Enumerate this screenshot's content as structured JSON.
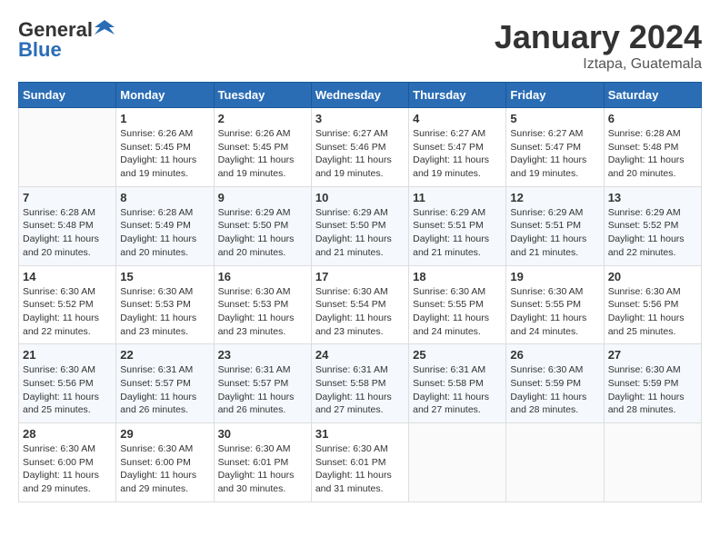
{
  "header": {
    "logo_general": "General",
    "logo_blue": "Blue",
    "month_title": "January 2024",
    "location": "Iztapa, Guatemala"
  },
  "weekdays": [
    "Sunday",
    "Monday",
    "Tuesday",
    "Wednesday",
    "Thursday",
    "Friday",
    "Saturday"
  ],
  "weeks": [
    [
      {
        "day": "",
        "info": ""
      },
      {
        "day": "1",
        "info": "Sunrise: 6:26 AM\nSunset: 5:45 PM\nDaylight: 11 hours and 19 minutes."
      },
      {
        "day": "2",
        "info": "Sunrise: 6:26 AM\nSunset: 5:45 PM\nDaylight: 11 hours and 19 minutes."
      },
      {
        "day": "3",
        "info": "Sunrise: 6:27 AM\nSunset: 5:46 PM\nDaylight: 11 hours and 19 minutes."
      },
      {
        "day": "4",
        "info": "Sunrise: 6:27 AM\nSunset: 5:47 PM\nDaylight: 11 hours and 19 minutes."
      },
      {
        "day": "5",
        "info": "Sunrise: 6:27 AM\nSunset: 5:47 PM\nDaylight: 11 hours and 19 minutes."
      },
      {
        "day": "6",
        "info": "Sunrise: 6:28 AM\nSunset: 5:48 PM\nDaylight: 11 hours and 20 minutes."
      }
    ],
    [
      {
        "day": "7",
        "info": "Sunrise: 6:28 AM\nSunset: 5:48 PM\nDaylight: 11 hours and 20 minutes."
      },
      {
        "day": "8",
        "info": "Sunrise: 6:28 AM\nSunset: 5:49 PM\nDaylight: 11 hours and 20 minutes."
      },
      {
        "day": "9",
        "info": "Sunrise: 6:29 AM\nSunset: 5:50 PM\nDaylight: 11 hours and 20 minutes."
      },
      {
        "day": "10",
        "info": "Sunrise: 6:29 AM\nSunset: 5:50 PM\nDaylight: 11 hours and 21 minutes."
      },
      {
        "day": "11",
        "info": "Sunrise: 6:29 AM\nSunset: 5:51 PM\nDaylight: 11 hours and 21 minutes."
      },
      {
        "day": "12",
        "info": "Sunrise: 6:29 AM\nSunset: 5:51 PM\nDaylight: 11 hours and 21 minutes."
      },
      {
        "day": "13",
        "info": "Sunrise: 6:29 AM\nSunset: 5:52 PM\nDaylight: 11 hours and 22 minutes."
      }
    ],
    [
      {
        "day": "14",
        "info": "Sunrise: 6:30 AM\nSunset: 5:52 PM\nDaylight: 11 hours and 22 minutes."
      },
      {
        "day": "15",
        "info": "Sunrise: 6:30 AM\nSunset: 5:53 PM\nDaylight: 11 hours and 23 minutes."
      },
      {
        "day": "16",
        "info": "Sunrise: 6:30 AM\nSunset: 5:53 PM\nDaylight: 11 hours and 23 minutes."
      },
      {
        "day": "17",
        "info": "Sunrise: 6:30 AM\nSunset: 5:54 PM\nDaylight: 11 hours and 23 minutes."
      },
      {
        "day": "18",
        "info": "Sunrise: 6:30 AM\nSunset: 5:55 PM\nDaylight: 11 hours and 24 minutes."
      },
      {
        "day": "19",
        "info": "Sunrise: 6:30 AM\nSunset: 5:55 PM\nDaylight: 11 hours and 24 minutes."
      },
      {
        "day": "20",
        "info": "Sunrise: 6:30 AM\nSunset: 5:56 PM\nDaylight: 11 hours and 25 minutes."
      }
    ],
    [
      {
        "day": "21",
        "info": "Sunrise: 6:30 AM\nSunset: 5:56 PM\nDaylight: 11 hours and 25 minutes."
      },
      {
        "day": "22",
        "info": "Sunrise: 6:31 AM\nSunset: 5:57 PM\nDaylight: 11 hours and 26 minutes."
      },
      {
        "day": "23",
        "info": "Sunrise: 6:31 AM\nSunset: 5:57 PM\nDaylight: 11 hours and 26 minutes."
      },
      {
        "day": "24",
        "info": "Sunrise: 6:31 AM\nSunset: 5:58 PM\nDaylight: 11 hours and 27 minutes."
      },
      {
        "day": "25",
        "info": "Sunrise: 6:31 AM\nSunset: 5:58 PM\nDaylight: 11 hours and 27 minutes."
      },
      {
        "day": "26",
        "info": "Sunrise: 6:30 AM\nSunset: 5:59 PM\nDaylight: 11 hours and 28 minutes."
      },
      {
        "day": "27",
        "info": "Sunrise: 6:30 AM\nSunset: 5:59 PM\nDaylight: 11 hours and 28 minutes."
      }
    ],
    [
      {
        "day": "28",
        "info": "Sunrise: 6:30 AM\nSunset: 6:00 PM\nDaylight: 11 hours and 29 minutes."
      },
      {
        "day": "29",
        "info": "Sunrise: 6:30 AM\nSunset: 6:00 PM\nDaylight: 11 hours and 29 minutes."
      },
      {
        "day": "30",
        "info": "Sunrise: 6:30 AM\nSunset: 6:01 PM\nDaylight: 11 hours and 30 minutes."
      },
      {
        "day": "31",
        "info": "Sunrise: 6:30 AM\nSunset: 6:01 PM\nDaylight: 11 hours and 31 minutes."
      },
      {
        "day": "",
        "info": ""
      },
      {
        "day": "",
        "info": ""
      },
      {
        "day": "",
        "info": ""
      }
    ]
  ]
}
